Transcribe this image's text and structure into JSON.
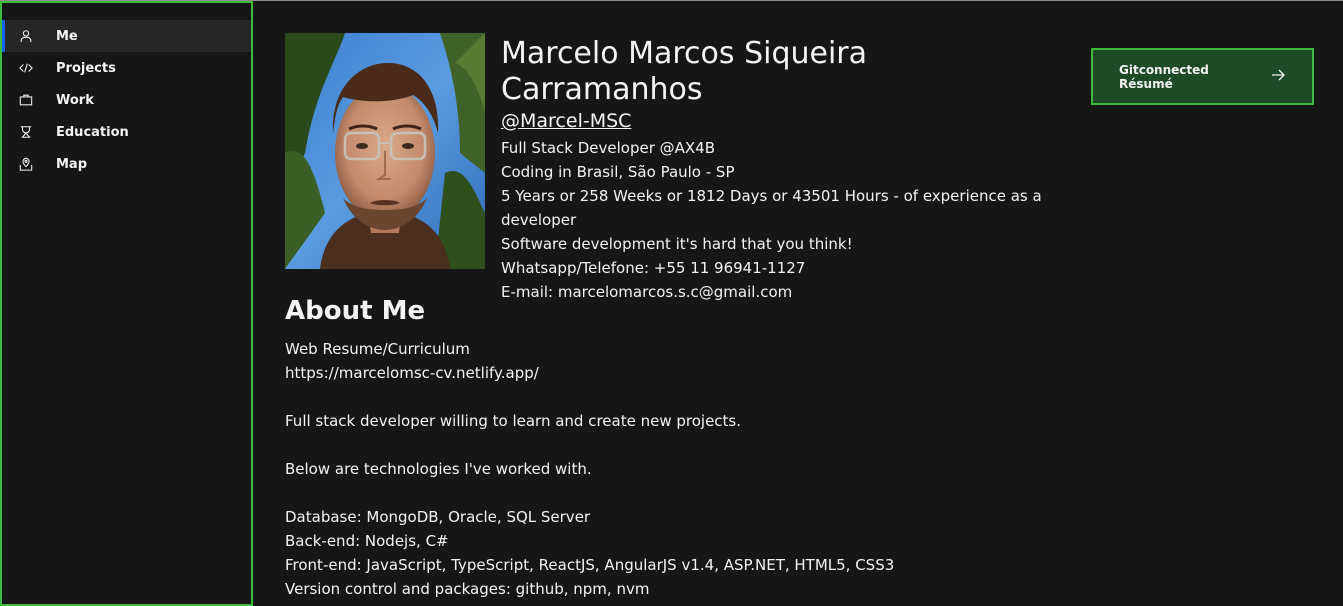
{
  "sidebar": {
    "items": [
      {
        "label": "Me",
        "icon": "user-icon"
      },
      {
        "label": "Projects",
        "icon": "code-icon"
      },
      {
        "label": "Work",
        "icon": "briefcase-icon"
      },
      {
        "label": "Education",
        "icon": "education-icon"
      },
      {
        "label": "Map",
        "icon": "map-icon"
      }
    ]
  },
  "profile": {
    "name": "Marcelo Marcos Siqueira Carramanhos",
    "username": "@Marcel-MSC",
    "lines": [
      "Full Stack Developer @AX4B",
      "Coding in Brasil, São Paulo - SP",
      "5 Years or 258 Weeks or 1812 Days or 43501 Hours - of experience as a",
      "developer",
      "Software development it's hard that you think!",
      "Whatsapp/Telefone: +55 11 96941-1127",
      "E-mail: marcelomarcos.s.c@gmail.com"
    ]
  },
  "resume_button": {
    "label": "Gitconnected\nRésumé"
  },
  "about": {
    "title": "About Me",
    "lines": [
      "Web Resume/Curriculum",
      "https://marcelomsc-cv.netlify.app/",
      "",
      "Full stack developer willing to learn and create new projects.",
      "",
      "Below are technologies I've worked with.",
      "",
      "Database: MongoDB, Oracle, SQL Server",
      "Back-end: Nodejs, C#",
      "Front-end: JavaScript, TypeScript, ReactJS, AngularJS v1.4, ASP.NET, HTML5, CSS3",
      "Version control and packages: github, npm, nvm"
    ]
  },
  "colors": {
    "background": "#161616",
    "accent_green": "#3dbb3d",
    "active_blue": "#0f62fe"
  }
}
